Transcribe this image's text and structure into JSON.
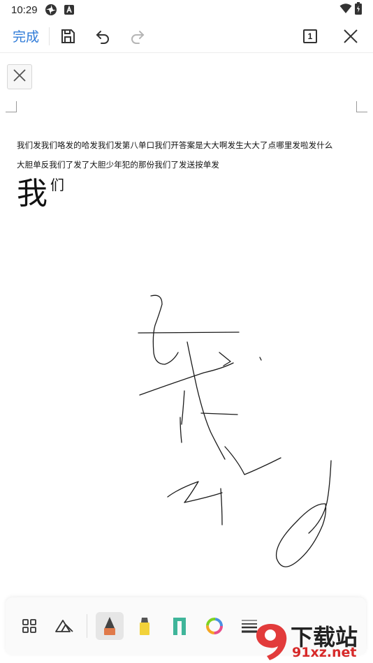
{
  "status_bar": {
    "time": "10:29",
    "icons": [
      "pinwheel-icon",
      "a-badge-icon",
      "wifi-icon",
      "battery-icon"
    ]
  },
  "toolbar": {
    "done_label": "完成",
    "page_indicator": "1",
    "icons": [
      "save-icon",
      "undo-icon",
      "redo-icon",
      "page-icon",
      "close-icon"
    ]
  },
  "document": {
    "line1": "我们发我们咯发的哈发我们发第八单口我们开答案是大大啊发生大大了点哪里发啦发什么",
    "line2": "大胆单反我们了发了大胆少年犯的那份我们了发送按单发",
    "big_char": "我",
    "sup_char": "们"
  },
  "pen_bar": {
    "tools": [
      "layout-icon",
      "eraser-icon",
      "pen-icon",
      "highlighter-icon",
      "marker-icon",
      "color-wheel-icon",
      "stroke-width-icon"
    ],
    "active_tool": "pen-icon",
    "colors": {
      "pen": "#e07a4a",
      "highlighter": "#f2d23a",
      "marker": "#3fb59a"
    }
  },
  "watermark": {
    "logo_text": "9",
    "cn": "下载站",
    "url": "91xz.net"
  }
}
